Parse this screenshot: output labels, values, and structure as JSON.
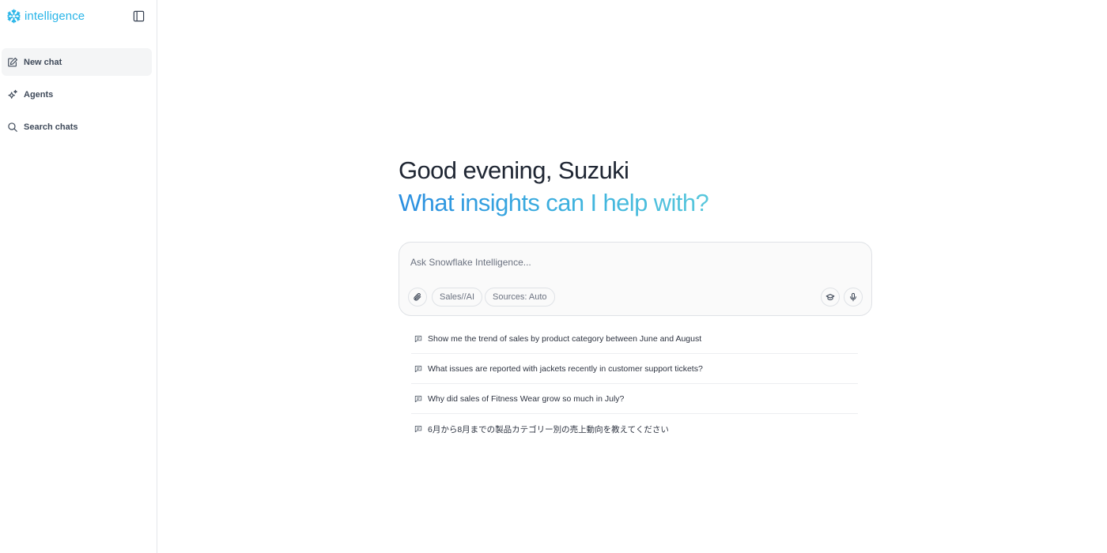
{
  "sidebar": {
    "brand": {
      "name": "intelligence",
      "icon": "snowflake-icon",
      "color": "#29b5e8"
    },
    "toggle_icon": "sidebar-toggle-icon",
    "items": [
      {
        "label": "New chat",
        "icon": "edit-icon",
        "active": true
      },
      {
        "label": "Agents",
        "icon": "sparkle-icon",
        "active": false
      },
      {
        "label": "Search chats",
        "icon": "search-icon",
        "active": false
      }
    ]
  },
  "main": {
    "greeting": "Good evening, Suzuki",
    "subheading": "What insights can I help with?",
    "composer": {
      "placeholder": "Ask Snowflake Intelligence...",
      "value": "",
      "attach_icon": "paperclip-icon",
      "agent_pill": "Sales//AI",
      "sources_pill": "Sources: Auto",
      "learn_icon": "graduation-cap-icon",
      "mic_icon": "microphone-icon"
    },
    "suggestions": [
      "Show me the trend of sales by product category between June and August",
      "What issues are reported with jackets recently in customer support tickets?",
      "Why did sales of Fitness Wear grow so much in July?",
      "6月から8月までの製品カテゴリー別の売上動向を教えてください"
    ],
    "suggestion_icon": "chat-bubble-icon"
  }
}
